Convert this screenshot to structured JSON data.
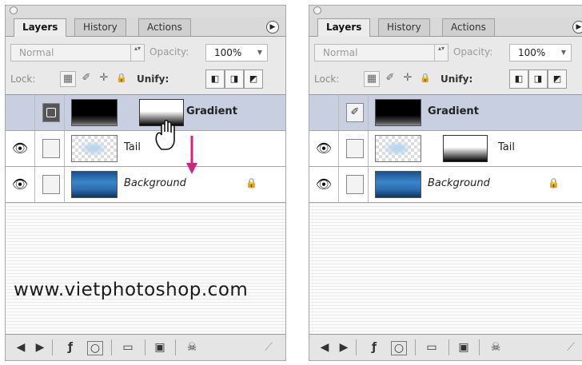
{
  "tabs": [
    "Layers",
    "History",
    "Actions"
  ],
  "menu_glyph": "▶",
  "blend_mode": "Normal",
  "blend_stepper": "▴▾",
  "opacity_label": "Opacity:",
  "opacity_value": "100%",
  "opacity_dropdown": "▼",
  "lock_label": "Lock:",
  "unify_label": "Unify:",
  "left_panel": {
    "layers": [
      {
        "name": "Gradient",
        "visible": false,
        "selected": true
      },
      {
        "name": "Tail",
        "visible": true,
        "selected": false
      },
      {
        "name": "Background",
        "visible": true,
        "selected": false,
        "locked": true
      }
    ]
  },
  "right_panel": {
    "layers": [
      {
        "name": "Gradient",
        "visible": false,
        "selected": true
      },
      {
        "name": "Tail",
        "visible": true,
        "selected": false
      },
      {
        "name": "Background",
        "visible": true,
        "selected": false,
        "locked": true
      }
    ]
  },
  "icons": {
    "eye": "👁",
    "brush": "✐",
    "move": "✛",
    "lock": "🔒",
    "grid": "▦",
    "fx": "ƒ",
    "folder": "▭",
    "newlayer": "▣",
    "trash": "☠",
    "prev": "◀",
    "next": "▶"
  },
  "watermark": "www.vietphotoshop.com",
  "colors": {
    "accent_arrow": "#d4237a",
    "selection": "#c8cfe0"
  }
}
